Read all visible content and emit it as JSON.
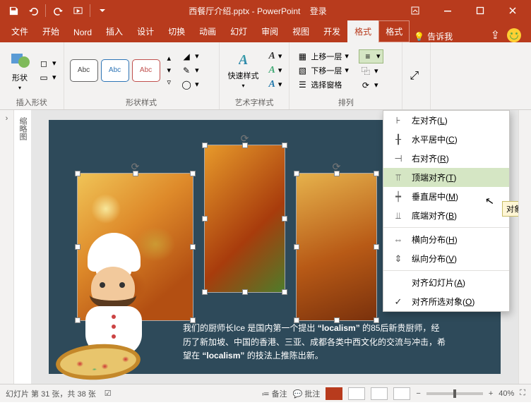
{
  "title": {
    "filename": "西餐厅介绍.pptx",
    "appname": "PowerPoint",
    "login": "登录"
  },
  "tabs": {
    "file": "文件",
    "home": "开始",
    "nord": "Nord",
    "insert": "插入",
    "design": "设计",
    "transitions": "切换",
    "animations": "动画",
    "slideshow": "幻灯",
    "review": "审阅",
    "view": "视图",
    "developer": "开发",
    "format1": "格式",
    "format2": "格式",
    "tellme": "告诉我"
  },
  "ribbon": {
    "shapes_btn": "形状",
    "insert_shapes_group": "插入形状",
    "abc": "Abc",
    "shape_styles_group": "形状样式",
    "quick_styles": "快速样式",
    "wordart_group": "艺术字样式",
    "bring_forward": "上移一层",
    "send_backward": "下移一层",
    "selection_pane": "选择窗格",
    "arrange_group": "排列"
  },
  "dropdown": {
    "align_left": "左对齐",
    "align_center": "水平居中",
    "align_right": "右对齐",
    "align_top": "顶端对齐",
    "align_middle": "垂直居中",
    "align_bottom": "底端对齐",
    "distribute_h": "横向分布",
    "distribute_v": "纵向分布",
    "align_slide": "对齐幻灯片",
    "align_selected": "对齐所选对象",
    "key_L": "L",
    "key_C": "C",
    "key_R": "R",
    "key_T": "T",
    "key_M": "M",
    "key_B": "B",
    "key_H": "H",
    "key_V": "V",
    "key_A": "A",
    "key_O": "O",
    "tooltip": "对象顶部对"
  },
  "outline_label": "缩略图",
  "slide_text": {
    "line1a": "我们的厨师长Ice 是国内第一个提出",
    "term": "“localism”",
    "line1b": "的85后新贵厨师，经",
    "line2": "历了新加坡、中国的香港、三亚、成都各类中西文化的交流与冲击，希",
    "line3a": "望在",
    "line3b": "的技法上推陈出新。"
  },
  "status": {
    "slide_info": "幻灯片 第 31 张，共 38 张",
    "notes": "备注",
    "comments": "批注",
    "zoom": "40%",
    "minus": "−",
    "plus": "+"
  }
}
